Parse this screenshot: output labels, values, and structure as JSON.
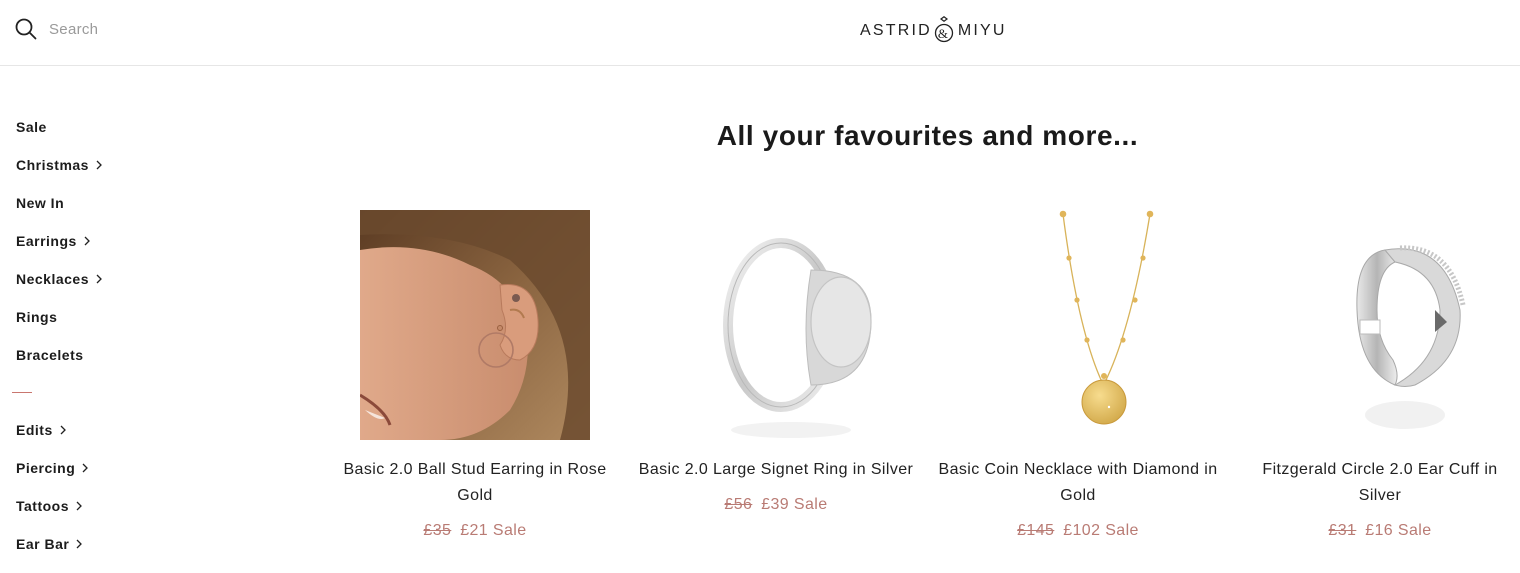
{
  "header": {
    "search_placeholder": "Search",
    "logo_left": "ASTRID",
    "logo_amp": "&",
    "logo_right": "MIYU"
  },
  "sidebar": {
    "items_top": [
      {
        "label": "Sale",
        "has_chevron": false
      },
      {
        "label": "Christmas",
        "has_chevron": true
      },
      {
        "label": "New In",
        "has_chevron": false
      },
      {
        "label": "Earrings",
        "has_chevron": true
      },
      {
        "label": "Necklaces",
        "has_chevron": true
      },
      {
        "label": "Rings",
        "has_chevron": false
      },
      {
        "label": "Bracelets",
        "has_chevron": false
      }
    ],
    "items_bottom": [
      {
        "label": "Edits",
        "has_chevron": true
      },
      {
        "label": "Piercing",
        "has_chevron": true
      },
      {
        "label": "Tattoos",
        "has_chevron": true
      },
      {
        "label": "Ear Bar",
        "has_chevron": true
      }
    ]
  },
  "main": {
    "heading": "All your favourites and more...",
    "products": [
      {
        "name": "Basic 2.0 Ball Stud Earring in Rose Gold",
        "was": "£35",
        "now": "£21 Sale",
        "image": "ear-model-photo"
      },
      {
        "name": "Basic 2.0 Large Signet Ring in Silver",
        "was": "£56",
        "now": "£39 Sale",
        "image": "silver-signet-ring"
      },
      {
        "name": "Basic Coin Necklace with Diamond in Gold",
        "was": "£145",
        "now": "£102 Sale",
        "image": "gold-coin-necklace"
      },
      {
        "name": "Fitzgerald Circle 2.0 Ear Cuff in Silver",
        "was": "£31",
        "now": "£16 Sale",
        "image": "silver-ear-cuff"
      }
    ]
  },
  "colors": {
    "sale_price": "#b97b74",
    "divider": "#c9766f",
    "text": "#1a1a1a"
  }
}
